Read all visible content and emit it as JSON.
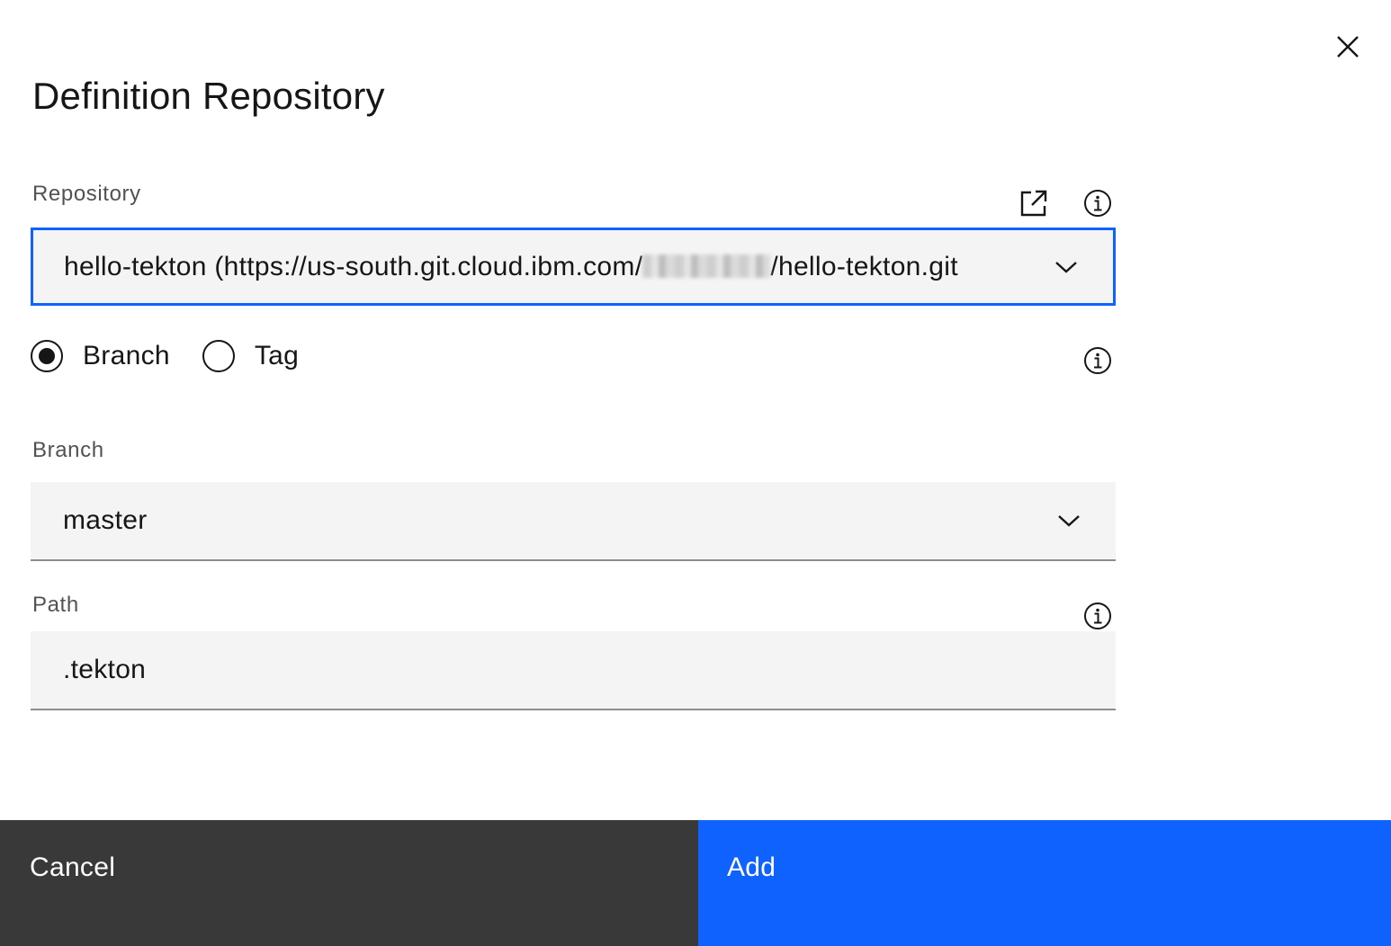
{
  "modal": {
    "title": "Definition Repository",
    "close_icon": "close-icon"
  },
  "repository": {
    "label": "Repository",
    "value_prefix": "hello-tekton (https://us-south.git.cloud.ibm.com/",
    "value_suffix": "/hello-tekton.git",
    "external_link_icon": "launch-icon",
    "info_icon": "information-icon",
    "dropdown_icon": "chevron-down-icon"
  },
  "ref_type": {
    "options": [
      {
        "label": "Branch",
        "selected": true
      },
      {
        "label": "Tag",
        "selected": false
      }
    ],
    "info_icon": "information-icon"
  },
  "branch": {
    "label": "Branch",
    "value": "master",
    "dropdown_icon": "chevron-down-icon"
  },
  "path": {
    "label": "Path",
    "value": ".tekton",
    "info_icon": "information-icon"
  },
  "footer": {
    "cancel_label": "Cancel",
    "add_label": "Add"
  },
  "colors": {
    "primary": "#0f62fe",
    "secondary_button": "#393939",
    "field_background": "#f4f4f4",
    "text": "#161616",
    "label_text": "#525252"
  }
}
